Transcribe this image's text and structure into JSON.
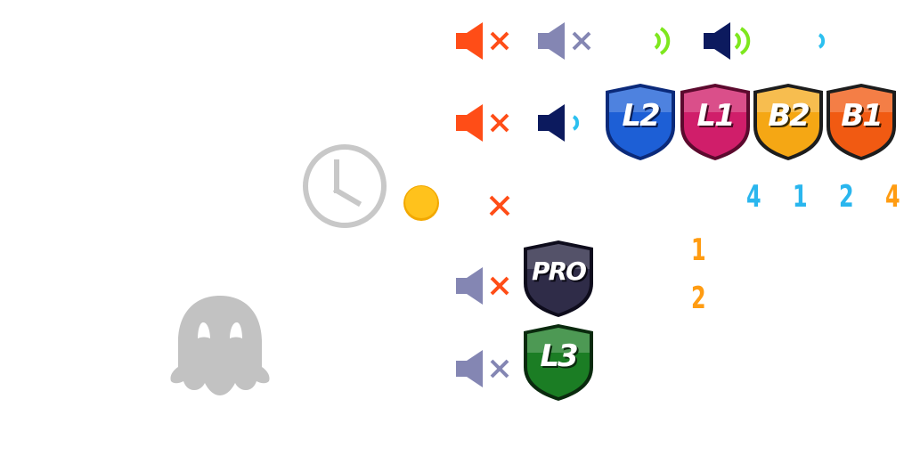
{
  "colors": {
    "mute_orange": "#ff4d17",
    "mute_gray": "#8486b3",
    "speaker_navy": "#0c1a5e",
    "wave_green": "#7ee71e",
    "wave_cyan": "#2cc0f0",
    "x_orange": "#ff4d17",
    "x_gray": "#8486b3",
    "clock_gray": "#c8c8c8",
    "coin_yellow": "#ffc21c",
    "ghost_gray": "#c2c2c2",
    "digit_cyan": "#2ab6ee",
    "digit_orange": "#ff9c12"
  },
  "badges": {
    "l2": {
      "label": "L2",
      "color": "#1d5fd6"
    },
    "l1": {
      "label": "L1",
      "color": "#d01e6a"
    },
    "b2": {
      "label": "B2",
      "color": "#f5a714"
    },
    "b1": {
      "label": "B1",
      "color": "#f15a12"
    },
    "pro": {
      "label": "PRO",
      "color": "#2f2c48"
    },
    "l3": {
      "label": "L3",
      "color": "#1b7d24"
    }
  },
  "digits": {
    "cyan_1": "4",
    "cyan_2": "1",
    "cyan_3": "2",
    "orange_top": "4",
    "orange_mid_1": "1",
    "orange_mid_2": "2"
  },
  "icons": {
    "speaker": "speaker-icon",
    "mute": "mute-x-icon",
    "wave": "sound-wave-icon",
    "clock": "clock-icon",
    "coin": "coin-icon",
    "ghost": "ghost-icon"
  }
}
